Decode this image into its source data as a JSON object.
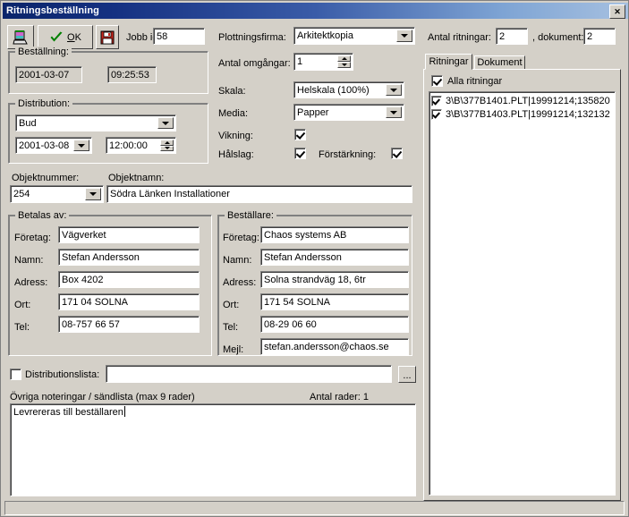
{
  "window": {
    "title": "Ritningsbeställning",
    "close_label": "✕"
  },
  "toolbar": {
    "plot_icon": "plotter-icon",
    "ok_label": "OK",
    "save_icon": "floppy-disk-icon",
    "jobb_id_label": "Jobb id:",
    "jobb_id_value": "58",
    "plottningsfirma_label": "Plottningsfirma:",
    "plottningsfirma_value": "Arkitektkopia",
    "antal_ritningar_label": "Antal ritningar:",
    "antal_ritningar_value": "2",
    "antal_dokument_label": ", dokument:",
    "antal_dokument_value": "2"
  },
  "bestallning": {
    "title": "Beställning:",
    "date": "2001-03-07",
    "time": "09:25:53"
  },
  "distribution": {
    "title": "Distribution:",
    "method": "Bud",
    "date": "2001-03-08",
    "time": "12:00:00"
  },
  "options": {
    "antal_omgangar_label": "Antal omgångar:",
    "antal_omgangar_value": "1",
    "skala_label": "Skala:",
    "skala_value": "Helskala (100%)",
    "media_label": "Media:",
    "media_value": "Papper",
    "vikning_label": "Vikning:",
    "vikning_checked": true,
    "halslag_label": "Hålslag:",
    "halslag_checked": true,
    "forstarkning_label": "Förstärkning:",
    "forstarkning_checked": true
  },
  "objekt": {
    "nummer_label": "Objektnummer:",
    "nummer_value": "254",
    "namn_label": "Objektnamn:",
    "namn_value": "Södra Länken Installationer"
  },
  "betalas_av": {
    "title": "Betalas av:",
    "fields": [
      {
        "label": "Företag:",
        "value": "Vägverket"
      },
      {
        "label": "Namn:",
        "value": "Stefan Andersson"
      },
      {
        "label": "Adress:",
        "value": "Box 4202"
      },
      {
        "label": "Ort:",
        "value": "171 04  SOLNA"
      },
      {
        "label": "Tel:",
        "value": "08-757 66 57"
      }
    ]
  },
  "bestallare": {
    "title": "Beställare:",
    "fields": [
      {
        "label": "Företag:",
        "value": "Chaos systems AB"
      },
      {
        "label": "Namn:",
        "value": "Stefan Andersson"
      },
      {
        "label": "Adress:",
        "value": "Solna strandväg 18, 6tr"
      },
      {
        "label": "Ort:",
        "value": "171 54  SOLNA"
      },
      {
        "label": "Tel:",
        "value": "08-29 06 60"
      },
      {
        "label": "Mejl:",
        "value": "stefan.andersson@chaos.se"
      }
    ]
  },
  "distributionslista": {
    "label": "Distributionslista:",
    "checked": false,
    "value": "",
    "browse_label": "..."
  },
  "notes": {
    "label": "Övriga noteringar / sändlista (max 9 rader)",
    "rows_label": "Antal rader: 1",
    "value": "Levrereras till beställaren"
  },
  "right_panel": {
    "tabs": [
      {
        "label": "Ritningar",
        "active": true
      },
      {
        "label": "Dokument",
        "active": false
      }
    ],
    "select_all_label": "Alla ritningar",
    "select_all_checked": true,
    "items": [
      {
        "label": "3\\B\\377B1401.PLT|19991214;135820",
        "checked": true
      },
      {
        "label": "3\\B\\377B1403.PLT|19991214;132132",
        "checked": true
      }
    ]
  }
}
